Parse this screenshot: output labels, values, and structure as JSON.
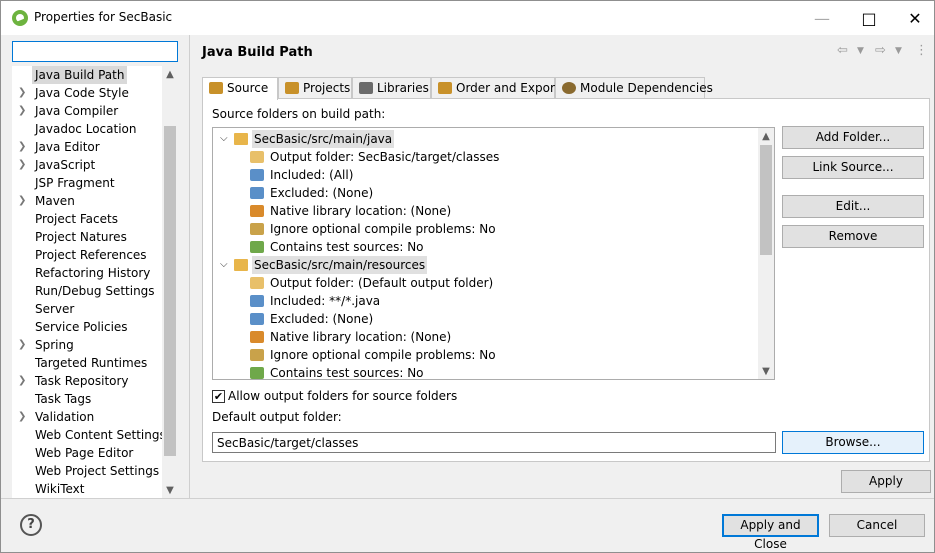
{
  "window": {
    "title": "Properties for SecBasic"
  },
  "filter": {
    "value": "",
    "placeholder": ""
  },
  "nav": {
    "items": [
      {
        "label": "Java Build Path",
        "expandable": false,
        "selected": true
      },
      {
        "label": "Java Code Style",
        "expandable": true
      },
      {
        "label": "Java Compiler",
        "expandable": true
      },
      {
        "label": "Javadoc Location",
        "expandable": false
      },
      {
        "label": "Java Editor",
        "expandable": true
      },
      {
        "label": "JavaScript",
        "expandable": true
      },
      {
        "label": "JSP Fragment",
        "expandable": false
      },
      {
        "label": "Maven",
        "expandable": true
      },
      {
        "label": "Project Facets",
        "expandable": false
      },
      {
        "label": "Project Natures",
        "expandable": false
      },
      {
        "label": "Project References",
        "expandable": false
      },
      {
        "label": "Refactoring History",
        "expandable": false
      },
      {
        "label": "Run/Debug Settings",
        "expandable": false
      },
      {
        "label": "Server",
        "expandable": false
      },
      {
        "label": "Service Policies",
        "expandable": false
      },
      {
        "label": "Spring",
        "expandable": true
      },
      {
        "label": "Targeted Runtimes",
        "expandable": false
      },
      {
        "label": "Task Repository",
        "expandable": true
      },
      {
        "label": "Task Tags",
        "expandable": false
      },
      {
        "label": "Validation",
        "expandable": true
      },
      {
        "label": "Web Content Settings",
        "expandable": false
      },
      {
        "label": "Web Page Editor",
        "expandable": false
      },
      {
        "label": "Web Project Settings",
        "expandable": false
      },
      {
        "label": "WikiText",
        "expandable": false
      }
    ]
  },
  "page": {
    "title": "Java Build Path"
  },
  "tabs": [
    {
      "label": "Source",
      "active": true,
      "icon": "source-folder-icon"
    },
    {
      "label": "Projects",
      "icon": "projects-icon"
    },
    {
      "label": "Libraries",
      "icon": "libraries-icon"
    },
    {
      "label": "Order and Export",
      "icon": "order-export-icon"
    },
    {
      "label": "Module Dependencies",
      "icon": "module-icon"
    }
  ],
  "source": {
    "heading": "Source folders on build path:",
    "folders": [
      {
        "path": "SecBasic/src/main/java",
        "children": [
          {
            "label": "Output folder: SecBasic/target/classes",
            "icon": "output-folder-icon"
          },
          {
            "label": "Included: (All)",
            "icon": "filter-icon"
          },
          {
            "label": "Excluded: (None)",
            "icon": "filter-icon"
          },
          {
            "label": "Native library location: (None)",
            "icon": "native-library-icon"
          },
          {
            "label": "Ignore optional compile problems: No",
            "icon": "ignore-problems-icon"
          },
          {
            "label": "Contains test sources: No",
            "icon": "test-sources-icon"
          }
        ]
      },
      {
        "path": "SecBasic/src/main/resources",
        "children": [
          {
            "label": "Output folder: (Default output folder)",
            "icon": "output-folder-icon"
          },
          {
            "label": "Included: **/*.java",
            "icon": "filter-icon"
          },
          {
            "label": "Excluded: (None)",
            "icon": "filter-icon"
          },
          {
            "label": "Native library location: (None)",
            "icon": "native-library-icon"
          },
          {
            "label": "Ignore optional compile problems: No",
            "icon": "ignore-problems-icon"
          },
          {
            "label": "Contains test sources: No",
            "icon": "test-sources-icon"
          }
        ]
      }
    ],
    "buttons": {
      "add_folder": "Add Folder...",
      "link_source": "Link Source...",
      "edit": "Edit...",
      "remove": "Remove"
    },
    "allow_output_label": "Allow output folders for source folders",
    "allow_output_checked": true,
    "default_output_label": "Default output folder:",
    "default_output_value": "SecBasic/target/classes",
    "browse_label": "Browse..."
  },
  "footer": {
    "apply": "Apply",
    "apply_close": "Apply and Close",
    "cancel": "Cancel",
    "help_glyph": "?"
  },
  "colors": {
    "accent": "#0078d7",
    "selection": "#d9d9d9",
    "spring_green": "#6db33f"
  }
}
